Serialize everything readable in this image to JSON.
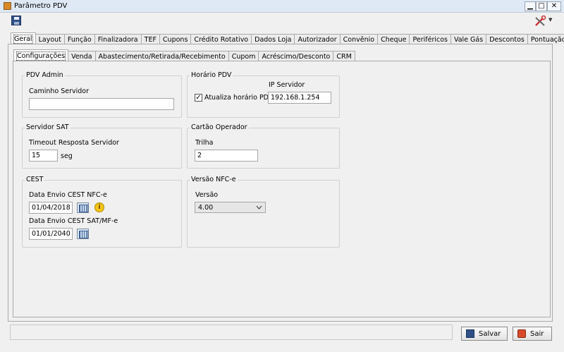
{
  "window": {
    "title": "Parâmetro PDV",
    "controls": {
      "minimize": "▁",
      "maximize": "□",
      "close": "✕"
    }
  },
  "toolbar": {
    "save_icon": "floppy-disk-icon",
    "tools_icon": "tools-icon",
    "tools_arrow": "▼"
  },
  "main_tabs": [
    "Geral",
    "Layout",
    "Função",
    "Finalizadora",
    "TEF",
    "Cupons",
    "Crédito Rotativo",
    "Dados Loja",
    "Autorizador",
    "Convênio",
    "Cheque",
    "Periféricos",
    "Vale Gás",
    "Descontos",
    "Pontuação"
  ],
  "active_main_tab": "Geral",
  "sub_tabs": [
    "Configurações",
    "Venda",
    "Abastecimento/Retirada/Recebimento",
    "Cupom",
    "Acréscimo/Desconto",
    "CRM"
  ],
  "active_sub_tab": "Configurações",
  "pdv_admin": {
    "title": "PDV Admin",
    "caminho_label": "Caminho Servidor",
    "caminho_value": ""
  },
  "horario_pdv": {
    "title": "Horário PDV",
    "atualiza_label": "Atualiza horário PDV",
    "atualiza_checked": "✓",
    "ip_label": "IP Servidor",
    "ip_value": "192.168.1.254"
  },
  "servidor_sat": {
    "title": "Servidor SAT",
    "timeout_label": "Timeout Resposta Servidor",
    "timeout_value": "15",
    "unit": "seg"
  },
  "cartao_operador": {
    "title": "Cartão Operador",
    "trilha_label": "Trilha",
    "trilha_value": "2"
  },
  "cest": {
    "title": "CEST",
    "nfce_label": "Data Envio CEST NFC-e",
    "nfce_value": "01/04/2018",
    "sat_label": "Data Envio CEST SAT/MF-e",
    "sat_value": "01/01/2040",
    "info_glyph": "i"
  },
  "versao_nfce": {
    "title": "Versão NFC-e",
    "versao_label": "Versão",
    "versao_value": "4.00"
  },
  "buttons": {
    "salvar": "Salvar",
    "sair": "Sair"
  }
}
